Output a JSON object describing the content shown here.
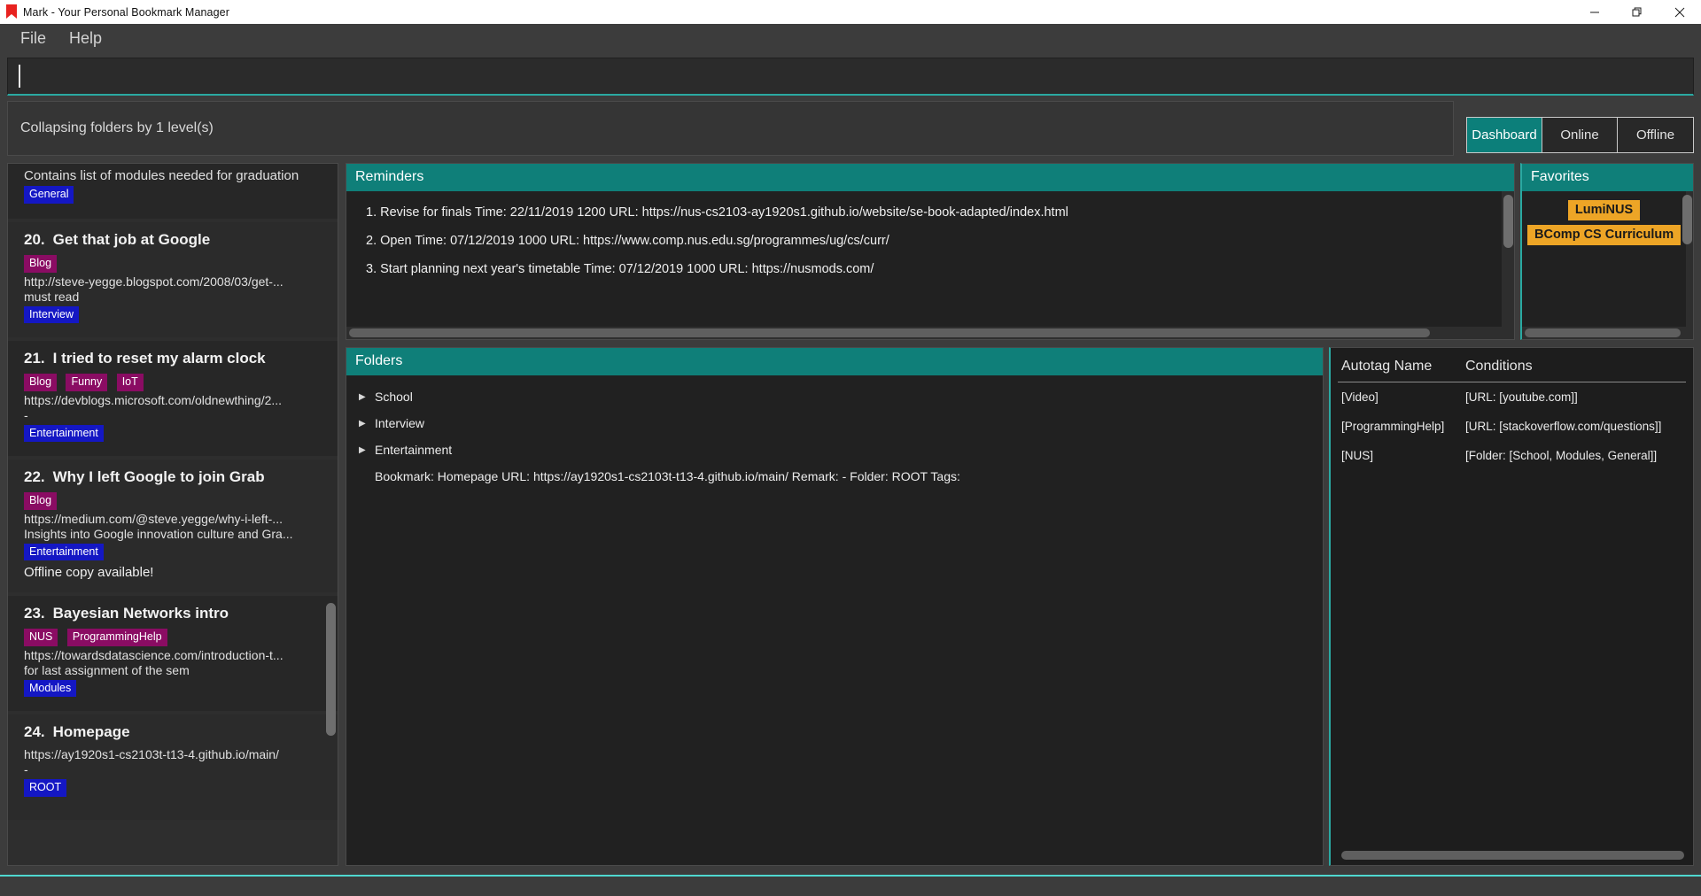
{
  "window": {
    "title": "Mark - Your Personal Bookmark Manager",
    "icon": "bookmark-icon",
    "controls": {
      "minimize": "minimize-icon",
      "maximize": "maximize-icon",
      "close": "close-icon"
    }
  },
  "menubar": {
    "items": [
      {
        "label": "File"
      },
      {
        "label": "Help"
      }
    ]
  },
  "command_box": {
    "value": "",
    "placeholder": ""
  },
  "result_display": {
    "text": "Collapsing folders by 1 level(s)"
  },
  "tabs": [
    {
      "label": "Dashboard",
      "active": true
    },
    {
      "label": "Online",
      "active": false
    },
    {
      "label": "Offline",
      "active": false
    }
  ],
  "bookmark_list": {
    "items": [
      {
        "index": "",
        "title": "",
        "description": "Contains list of modules needed for graduation",
        "tags_top": [],
        "url": "",
        "remark": "",
        "tags_bottom": [
          {
            "label": "General",
            "color": "blue"
          }
        ],
        "offline_note": ""
      },
      {
        "index": "20.",
        "title": "Get that job at Google",
        "description": "",
        "tags_top": [
          {
            "label": "Blog",
            "color": "magenta"
          }
        ],
        "url": "http://steve-yegge.blogspot.com/2008/03/get-...",
        "remark": "must read",
        "tags_bottom": [
          {
            "label": "Interview",
            "color": "blue"
          }
        ],
        "offline_note": ""
      },
      {
        "index": "21.",
        "title": "I tried to reset my alarm clock",
        "description": "",
        "tags_top": [
          {
            "label": "Blog",
            "color": "magenta"
          },
          {
            "label": "Funny",
            "color": "magenta"
          },
          {
            "label": "IoT",
            "color": "magenta"
          }
        ],
        "url": "https://devblogs.microsoft.com/oldnewthing/2...",
        "remark": "-",
        "tags_bottom": [
          {
            "label": "Entertainment",
            "color": "blue"
          }
        ],
        "offline_note": ""
      },
      {
        "index": "22.",
        "title": "Why I left Google to join Grab",
        "description": "",
        "tags_top": [
          {
            "label": "Blog",
            "color": "magenta"
          }
        ],
        "url": "https://medium.com/@steve.yegge/why-i-left-...",
        "remark": "Insights into Google innovation culture and Gra...",
        "tags_bottom": [
          {
            "label": "Entertainment",
            "color": "blue"
          }
        ],
        "offline_note": "Offline copy available!"
      },
      {
        "index": "23.",
        "title": "Bayesian Networks intro",
        "description": "",
        "tags_top": [
          {
            "label": "NUS",
            "color": "magenta"
          },
          {
            "label": "ProgrammingHelp",
            "color": "magenta"
          }
        ],
        "url": "https://towardsdatascience.com/introduction-t...",
        "remark": "for last assignment of the sem",
        "tags_bottom": [
          {
            "label": "Modules",
            "color": "blue"
          }
        ],
        "offline_note": ""
      },
      {
        "index": "24.",
        "title": "Homepage",
        "description": "",
        "tags_top": [],
        "url": "https://ay1920s1-cs2103t-t13-4.github.io/main/",
        "remark": "-",
        "tags_bottom": [
          {
            "label": "ROOT",
            "color": "blue"
          }
        ],
        "offline_note": ""
      }
    ]
  },
  "reminders": {
    "title": "Reminders",
    "items": [
      "1. Revise for finals Time: 22/11/2019 1200 URL: https://nus-cs2103-ay1920s1.github.io/website/se-book-adapted/index.html",
      "2. Open Time: 07/12/2019 1000 URL: https://www.comp.nus.edu.sg/programmes/ug/cs/curr/",
      "3. Start planning next year's timetable Time: 07/12/2019 1000 URL: https://nusmods.com/"
    ]
  },
  "favorites": {
    "title": "Favorites",
    "items": [
      "LumiNUS",
      "BComp CS Curriculum"
    ]
  },
  "folders": {
    "title": "Folders",
    "nodes": [
      {
        "label": "School",
        "expanded": false
      },
      {
        "label": "Interview",
        "expanded": false
      },
      {
        "label": "Entertainment",
        "expanded": false
      }
    ],
    "leaf": "Bookmark: Homepage URL: https://ay1920s1-cs2103t-t13-4.github.io/main/ Remark: - Folder: ROOT Tags:"
  },
  "autotags": {
    "columns": [
      "Autotag Name",
      "Conditions"
    ],
    "rows": [
      {
        "name": "[Video]",
        "conditions": "[URL: [youtube.com]]"
      },
      {
        "name": "[ProgrammingHelp]",
        "conditions": "[URL: [stackoverflow.com/questions]]"
      },
      {
        "name": "[NUS]",
        "conditions": "[Folder: [School, Modules, General]]"
      }
    ]
  },
  "colors": {
    "accent_teal": "#0f7f79",
    "accent_cyan": "#4fd8d0",
    "tag_blue": "#1417c4",
    "tag_magenta": "#8a0c63",
    "favorite_orange": "#eda526",
    "background": "#3c3c3c"
  }
}
